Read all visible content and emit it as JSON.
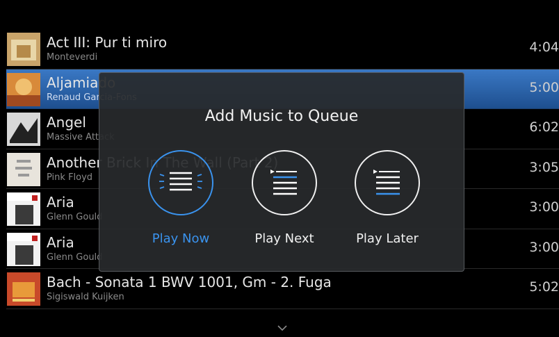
{
  "tracks": [
    {
      "title": "Act III: Pur ti miro",
      "artist": "Monteverdi",
      "duration": "4:04",
      "selected": false
    },
    {
      "title": "Aljamiado",
      "artist": "Renaud Garcia-Fons",
      "duration": "5:00",
      "selected": true
    },
    {
      "title": "Angel",
      "artist": "Massive Attack",
      "duration": "6:02",
      "selected": false
    },
    {
      "title": "Another Brick In The Wall (Part 2)",
      "artist": "Pink Floyd",
      "duration": "3:05",
      "selected": false
    },
    {
      "title": "Aria",
      "artist": "Glenn Gould",
      "duration": "3:00",
      "selected": false
    },
    {
      "title": "Aria",
      "artist": "Glenn Gould",
      "duration": "3:00",
      "selected": false
    },
    {
      "title": "Bach - Sonata 1 BWV 1001, Gm - 2. Fuga",
      "artist": "Sigiswald Kuijken",
      "duration": "5:02",
      "selected": false
    }
  ],
  "modal": {
    "title": "Add Music to Queue",
    "options": [
      {
        "label": "Play Now",
        "icon": "play-now-icon",
        "active": true
      },
      {
        "label": "Play Next",
        "icon": "play-next-icon",
        "active": false
      },
      {
        "label": "Play Later",
        "icon": "play-later-icon",
        "active": false
      }
    ]
  },
  "colors": {
    "accent": "#3a93ee",
    "selected_row": "#2e6ab3",
    "modal_bg": "#282a2c"
  },
  "scroll_indicator": "chevron-down-icon"
}
